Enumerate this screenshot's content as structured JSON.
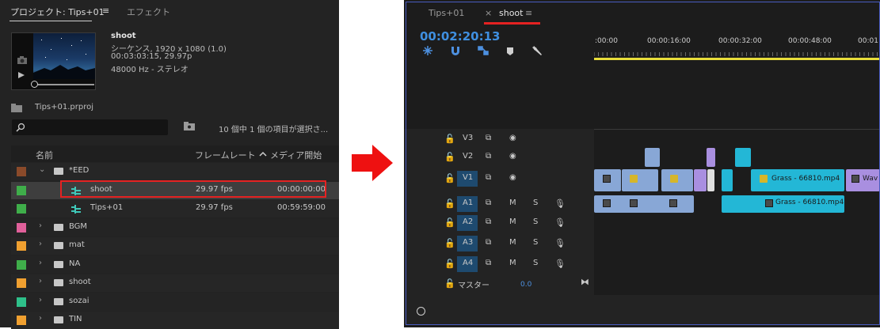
{
  "project_panel": {
    "tabs": [
      {
        "label": "プロジェクト: Tips+01"
      },
      {
        "label": "≡"
      },
      {
        "label": "エフェクト"
      }
    ],
    "clip_info": {
      "name": "shoot",
      "line1": "シーケンス, 1920 x 1080 (1.0)",
      "line2": "00:03:03:15, 29.97p",
      "line3": "48000 Hz - ステレオ"
    },
    "project_file": "Tips+01.prproj",
    "search_placeholder": "",
    "selection_info": "10 個中 1 個の項目が選択さ...",
    "columns": {
      "name": "名前",
      "framerate": "フレームレート",
      "media_start": "メディア開始"
    },
    "rows": [
      {
        "label": "*EED",
        "type": "folder",
        "expanded": true,
        "color": "#8a4a2a",
        "fps": "",
        "start": ""
      },
      {
        "label": "shoot",
        "type": "sequence",
        "selected": true,
        "color": "#3fae4a",
        "fps": "29.97 fps",
        "start": "00:00:00:00"
      },
      {
        "label": "Tips+01",
        "type": "sequence",
        "color": "#3fae4a",
        "fps": "29.97 fps",
        "start": "00:59:59:00"
      },
      {
        "label": "BGM",
        "type": "folder",
        "color": "#e0609a",
        "fps": "",
        "start": ""
      },
      {
        "label": "mat",
        "type": "folder",
        "color": "#f0a030",
        "fps": "",
        "start": ""
      },
      {
        "label": "NA",
        "type": "folder",
        "color": "#3fae4a",
        "fps": "",
        "start": ""
      },
      {
        "label": "shoot",
        "type": "folder",
        "color": "#f0a030",
        "fps": "",
        "start": ""
      },
      {
        "label": "sozai",
        "type": "folder",
        "color": "#2ec08a",
        "fps": "",
        "start": ""
      },
      {
        "label": "TIN",
        "type": "folder",
        "color": "#f0a030",
        "fps": "",
        "start": ""
      }
    ]
  },
  "timeline_panel": {
    "tabs": [
      {
        "label": "Tips+01"
      },
      {
        "label": "×"
      },
      {
        "label": "shoot"
      },
      {
        "label": "≡"
      }
    ],
    "timecode": "00:02:20:13",
    "ruler_labels": [
      ":00:00",
      "00:00:16:00",
      "00:00:32:00",
      "00:00:48:00",
      "00:01"
    ],
    "video_tracks": [
      {
        "name": "V3",
        "lock": "🔓",
        "sync": "⧉",
        "eye": "◉"
      },
      {
        "name": "V2",
        "lock": "🔓",
        "sync": "⧉",
        "eye": "◉"
      },
      {
        "name": "V1",
        "lock": "🔓",
        "sync": "⧉",
        "eye": "◉",
        "targeted": true
      }
    ],
    "audio_tracks": [
      {
        "name": "A1",
        "lock": "🔓",
        "sync": "⧉",
        "m": "M",
        "s": "S",
        "mic": "🎙",
        "targeted": true
      },
      {
        "name": "A2",
        "lock": "🔓",
        "sync": "⧉",
        "m": "M",
        "s": "S",
        "mic": "🎙",
        "targeted": true
      },
      {
        "name": "A3",
        "lock": "🔓",
        "sync": "⧉",
        "m": "M",
        "s": "S",
        "mic": "🎙",
        "targeted": true
      },
      {
        "name": "A4",
        "lock": "🔓",
        "sync": "⧉",
        "m": "M",
        "s": "S",
        "mic": "🎙",
        "targeted": true
      }
    ],
    "master": {
      "label": "マスター",
      "value": "0.0",
      "end_icon": "⧓"
    },
    "clips": {
      "v1_grass": "Grass - 66810.mp4",
      "v1_wav": "Wav",
      "a1_grass": "Grass - 66810.mp4"
    },
    "colors": {
      "video_clip": "#88a7d6",
      "selected_clip": "#23b7d6",
      "purple_clip": "#a98fe0",
      "accent": "#3f8fe0",
      "work_area": "#e8dd3b"
    }
  },
  "annotations": {
    "highlight_color": "#e52222",
    "arrow_color": "#ee1111"
  }
}
